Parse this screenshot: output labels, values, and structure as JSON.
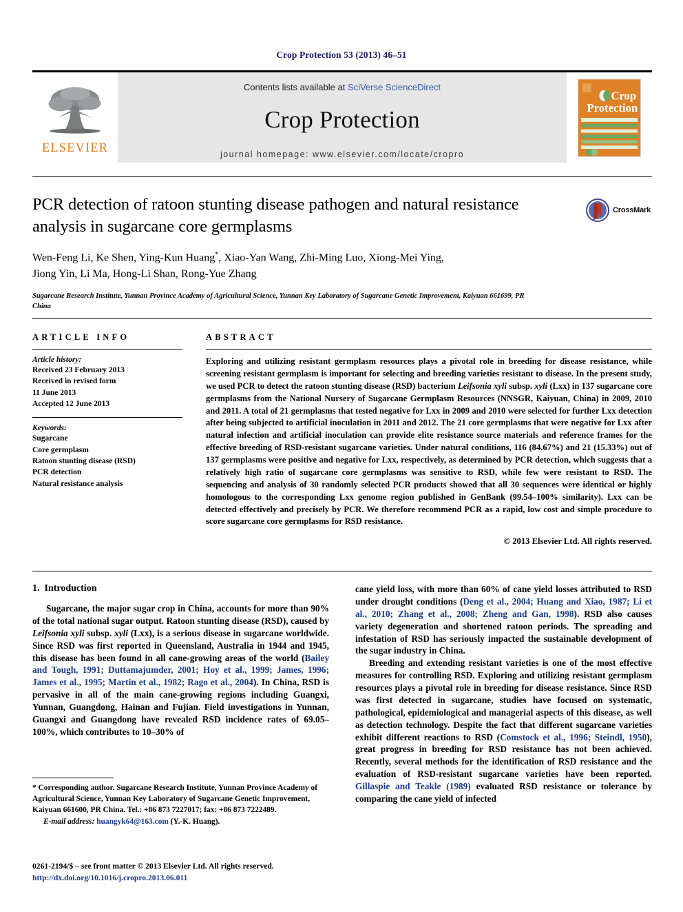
{
  "running_head": "Crop Protection 53 (2013) 46–51",
  "masthead": {
    "contents_prefix": "Contents lists available at ",
    "sciencedirect": "SciVerse ScienceDirect",
    "journal_title": "Crop Protection",
    "homepage": "journal homepage: www.elsevier.com/locate/cropro",
    "publisher_wordmark": "ELSEVIER",
    "cover_title_line1": "Crop",
    "cover_title_line2": "Protection",
    "accent_orange": "#e87b1e",
    "link_blue": "#3557a8",
    "cover_bg": "#df8227",
    "cover_green": "#6aa861"
  },
  "article": {
    "title": "PCR detection of ratoon stunting disease pathogen and natural resistance analysis in sugarcane core germplasms",
    "authors_line1": "Wen-Feng Li, Ke Shen, Ying-Kun Huang",
    "authors_star": "*",
    "authors_line1_rest": ", Xiao-Yan Wang, Zhi-Ming Luo, Xiong-Mei Ying,",
    "authors_line2": "Jiong Yin, Li Ma, Hong-Li Shan, Rong-Yue Zhang",
    "affiliation": "Sugarcane Research Institute, Yunnan Province Academy of Agricultural Science, Yunnan Key Laboratory of Sugarcane Genetic Improvement, Kaiyuan 661699, PR China",
    "crossmark_label": "CrossMark"
  },
  "article_info": {
    "heading": "ARTICLE INFO",
    "history_label": "Article history:",
    "history": [
      "Received 23 February 2013",
      "Received in revised form",
      "11 June 2013",
      "Accepted 12 June 2013"
    ],
    "keywords_label": "Keywords:",
    "keywords": [
      "Sugarcane",
      "Core germplasm",
      "Ratoon stunting disease (RSD)",
      "PCR detection",
      "Natural resistance analysis"
    ]
  },
  "abstract": {
    "heading": "ABSTRACT",
    "text_part1": "Exploring and utilizing resistant germplasm resources plays a pivotal role in breeding for disease resistance, while screening resistant germplasm is important for selecting and breeding varieties resistant to disease. In the present study, we used PCR to detect the ratoon stunting disease (RSD) bacterium ",
    "italic1": "Leifsonia xyli",
    "text_part2": " subsp. ",
    "italic2": "xyli",
    "text_part3": " (Lxx) in 137 sugarcane core germplasms from the National Nursery of Sugarcane Germplasm Resources (NNSGR, Kaiyuan, China) in 2009, 2010 and 2011. A total of 21 germplasms that tested negative for Lxx in 2009 and 2010 were selected for further Lxx detection after being subjected to artificial inoculation in 2011 and 2012. The 21 core germplasms that were negative for Lxx after natural infection and artificial inoculation can provide elite resistance source materials and reference frames for the effective breeding of RSD-resistant sugarcane varieties. Under natural conditions, 116 (84.67%) and 21 (15.33%) out of 137 germplasms were positive and negative for Lxx, respectively, as determined by PCR detection, which suggests that a relatively high ratio of sugarcane core germplasms was sensitive to RSD, while few were resistant to RSD. The sequencing and analysis of 30 randomly selected PCR products showed that all 30 sequences were identical or highly homologous to the corresponding Lxx genome region published in GenBank (99.54–100% similarity). Lxx can be detected effectively and precisely by PCR. We therefore recommend PCR as a rapid, low cost and simple procedure to score sugarcane core germplasms for RSD resistance.",
    "copyright": "© 2013 Elsevier Ltd. All rights reserved."
  },
  "introduction": {
    "number": "1.",
    "title": "Introduction",
    "p1_a": "Sugarcane, the major sugar crop in China, accounts for more than 90% of the total national sugar output. Ratoon stunting disease (RSD), caused by ",
    "p1_italic1": "Leifsonia xyli",
    "p1_b": " subsp. ",
    "p1_italic2": "xyli",
    "p1_c": " (Lxx), is a serious disease in sugarcane worldwide. Since RSD was first reported in Queensland, Australia in 1944 and 1945, this disease has been found in all cane-growing areas of the world (",
    "p1_cite1": "Bailey and Tough, 1991; Duttamajumder, 2001; Hoy et al., 1999; James, 1996; James et al., 1995; Martin et al., 1982; Rago et al., 2004",
    "p1_d": "). In China, RSD is pervasive in all of the main cane-growing regions including Guangxi, Yunnan, Guangdong, Hainan and Fujian. Field investigations in Yunnan, Guangxi and Guangdong have revealed RSD incidence rates of 69.05–100%, which contributes to 10–30% of",
    "p2_a": "cane yield loss, with more than 60% of cane yield losses attributed to RSD under drought conditions (",
    "p2_cite1": "Deng et al., 2004; Huang and Xiao, 1987; Li et al., 2010; Zhang et al., 2008; Zheng and Gan, 1998",
    "p2_b": "). RSD also causes variety degeneration and shortened ratoon periods. The spreading and infestation of RSD has seriously impacted the sustainable development of the sugar industry in China.",
    "p3_a": "Breeding and extending resistant varieties is one of the most effective measures for controlling RSD. Exploring and utilizing resistant germplasm resources plays a pivotal role in breeding for disease resistance. Since RSD was first detected in sugarcane, studies have focused on systematic, pathological, epidemiological and managerial aspects of this disease, as well as detection technology. Despite the fact that different sugarcane varieties exhibit different reactions to RSD (",
    "p3_cite1": "Comstock et al., 1996; Steindl, 1950",
    "p3_b": "), great progress in breeding for RSD resistance has not been achieved. Recently, several methods for the identification of RSD resistance and the evaluation of RSD-resistant sugarcane varieties have been reported. ",
    "p3_cite2": "Gillaspie and Teakle (1989)",
    "p3_c": " evaluated RSD resistance or tolerance by comparing the cane yield of infected"
  },
  "footnote": {
    "corresponding": "* Corresponding author. Sugarcane Research Institute, Yunnan Province Academy of Agricultural Science, Yunnan Key Laboratory of Sugarcane Genetic Improvement, Kaiyuan 661600, PR China. Tel.: +86 873 7227017; fax: +86 873 7222489.",
    "email_label": "E-mail address:",
    "email": "huangyk64@163.com",
    "email_suffix": " (Y.-K. Huang)."
  },
  "imprint": {
    "line1": "0261-2194/$ – see front matter © 2013 Elsevier Ltd. All rights reserved.",
    "doi": "http://dx.doi.org/10.1016/j.cropro.2013.06.011"
  }
}
